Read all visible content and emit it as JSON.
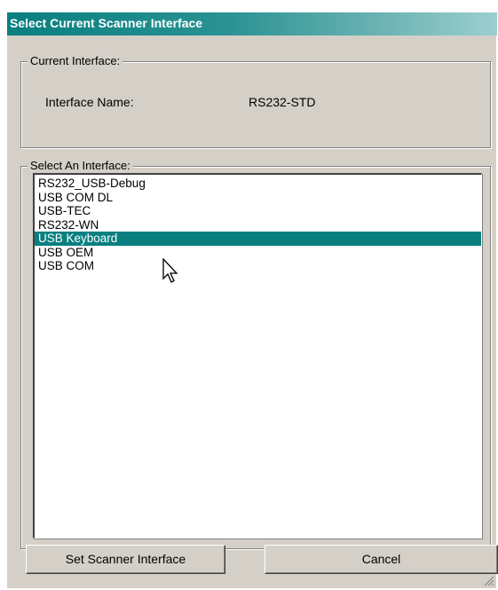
{
  "window": {
    "title": "Select Current Scanner Interface"
  },
  "current_interface": {
    "group_label": "Current Interface:",
    "name_label": "Interface Name:",
    "name_value": "RS232-STD"
  },
  "select_interface": {
    "group_label": "Select An Interface:",
    "items": [
      {
        "label": "RS232_USB-Debug",
        "selected": false
      },
      {
        "label": "USB COM DL",
        "selected": false
      },
      {
        "label": "USB-TEC",
        "selected": false
      },
      {
        "label": "RS232-WN",
        "selected": false
      },
      {
        "label": "USB Keyboard",
        "selected": true
      },
      {
        "label": "USB OEM",
        "selected": false
      },
      {
        "label": "USB COM",
        "selected": false
      }
    ]
  },
  "buttons": {
    "set_label": "Set Scanner Interface",
    "cancel_label": "Cancel"
  },
  "colors": {
    "titlebar": "#0a7f80",
    "selection": "#0a7f80",
    "face": "#d4d0c8"
  },
  "icons": {
    "pointer": "mouse-pointer-icon",
    "resize": "resize-grip-icon"
  }
}
